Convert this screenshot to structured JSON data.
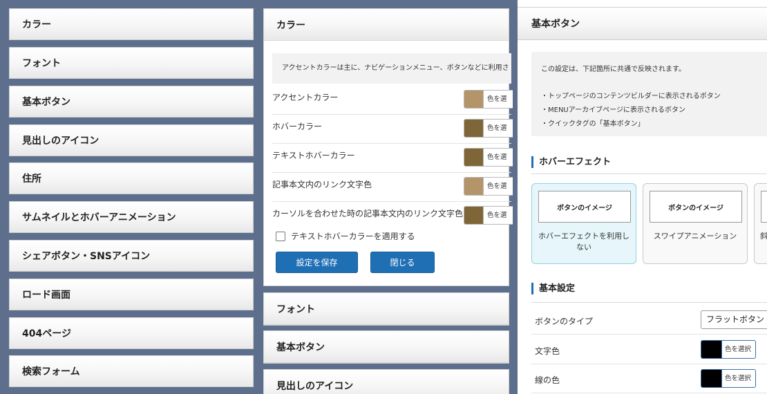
{
  "menu": {
    "items": [
      {
        "label": "カラー"
      },
      {
        "label": "フォント"
      },
      {
        "label": "基本ボタン"
      },
      {
        "label": "見出しのアイコン"
      },
      {
        "label": "住所"
      },
      {
        "label": "サムネイルとホバーアニメーション"
      },
      {
        "label": "シェアボタン・SNSアイコン"
      },
      {
        "label": "ロード画面"
      },
      {
        "label": "404ページ"
      },
      {
        "label": "検索フォーム"
      }
    ]
  },
  "color_panel": {
    "title": "カラー",
    "info": "アクセントカラーは主に、ナビゲーションメニュー、ボタンなどに利用さ",
    "rows": [
      {
        "label": "アクセントカラー",
        "color": "#b39569",
        "picker_label": "色を選"
      },
      {
        "label": "ホバーカラー",
        "color": "#7f6638",
        "picker_label": "色を選"
      },
      {
        "label": "テキストホバーカラー",
        "color": "#7f6638",
        "picker_label": "色を選"
      },
      {
        "label": "記事本文内のリンク文字色",
        "color": "#b39569",
        "picker_label": "色を選"
      },
      {
        "label": "カーソルを合わせた時の記事本文内のリンク文字色",
        "color": "#7f6638",
        "picker_label": "色を選"
      }
    ],
    "checkbox_label": "テキストホバーカラーを適用する",
    "save_label": "設定を保存",
    "close_label": "閉じる"
  },
  "collapsed_panels": [
    {
      "title": "フォント"
    },
    {
      "title": "基本ボタン"
    },
    {
      "title": "見出しのアイコン"
    }
  ],
  "button_panel": {
    "title": "基本ボタン",
    "notice": {
      "line1": "この設定は、下記箇所に共通で反映されます。",
      "line2": "・トップページのコンテンツビルダーに表示されるボタン",
      "line3": "・MENUアーカイブページに表示されるボタン",
      "line4": "・クイックタグの「基本ボタン」"
    },
    "hover_effect_title": "ホバーエフェクト",
    "effects": [
      {
        "preview": "ボタンのイメージ",
        "caption": "ホバーエフェクトを利用しない",
        "selected": true
      },
      {
        "preview": "ボタンのイメージ",
        "caption": "スワイプアニメーション",
        "selected": false
      },
      {
        "preview": "",
        "caption": "斜",
        "selected": false
      }
    ],
    "basic_settings_title": "基本設定",
    "settings": {
      "type_label": "ボタンのタイプ",
      "type_value": "フラットボタン",
      "text_color_label": "文字色",
      "text_color": "#000000",
      "border_color_label": "線の色",
      "border_color": "#000000",
      "picker_label": "色を選択"
    }
  },
  "colors": {
    "background": "#5d6f8c",
    "accent_blue": "#1f6fb5",
    "selected_card": "#e6f6fb"
  }
}
